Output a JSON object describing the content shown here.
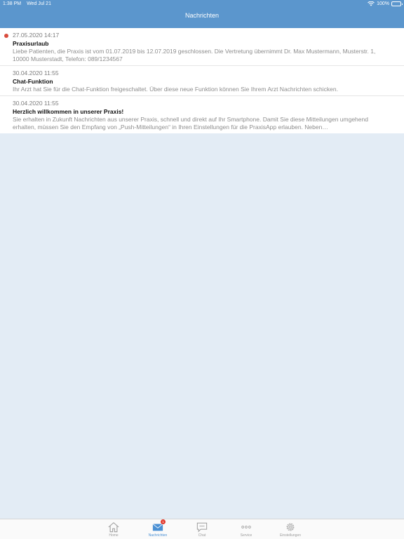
{
  "status_bar": {
    "time": "1:38 PM",
    "date": "Wed Jul 21",
    "battery": "100%"
  },
  "header": {
    "title": "Nachrichten"
  },
  "messages": [
    {
      "date": "27.05.2020 14:17",
      "title": "Praxisurlaub",
      "body": "Liebe Patienten, die Praxis ist vom 01.07.2019 bis 12.07.2019 geschlossen. Die Vertretung übernimmt Dr. Max Mustermann, Musterstr. 1, 10000 Musterstadt, Telefon: 089/1234567",
      "unread": true
    },
    {
      "date": "30.04.2020 11:55",
      "title": "Chat-Funktion",
      "body": "Ihr Arzt hat Sie für die Chat-Funktion freigeschaltet. Über diese neue Funktion können Sie Ihrem Arzt Nachrichten schicken.",
      "unread": false
    },
    {
      "date": "30.04.2020 11:55",
      "title": "Herzlich willkommen in unserer Praxis!",
      "body": "Sie erhalten in Zukunft Nachrichten aus unserer Praxis, schnell und direkt auf Ihr Smartphone. Damit Sie diese Mitteilungen umgehend erhalten, müssen Sie den Empfang von „Push-Mitteilungen“ in Ihren Einstellungen für die PraxisApp erlauben. Neben…",
      "unread": false
    }
  ],
  "tabbar": {
    "tabs": [
      {
        "label": "Home",
        "icon": "home-icon"
      },
      {
        "label": "Nachrichten",
        "icon": "envelope-icon",
        "active": true,
        "badge": "1"
      },
      {
        "label": "Chat",
        "icon": "chat-bubble-icon"
      },
      {
        "label": "Service",
        "icon": "more-dots-icon"
      },
      {
        "label": "Einstellungen",
        "icon": "gear-icon"
      }
    ]
  },
  "colors": {
    "header_bg": "#5b96cd",
    "background": "#e3ecf5",
    "unread_dot": "#d94c3d",
    "tab_active": "#4a90d4",
    "tab_inactive": "#9d9d9d"
  }
}
